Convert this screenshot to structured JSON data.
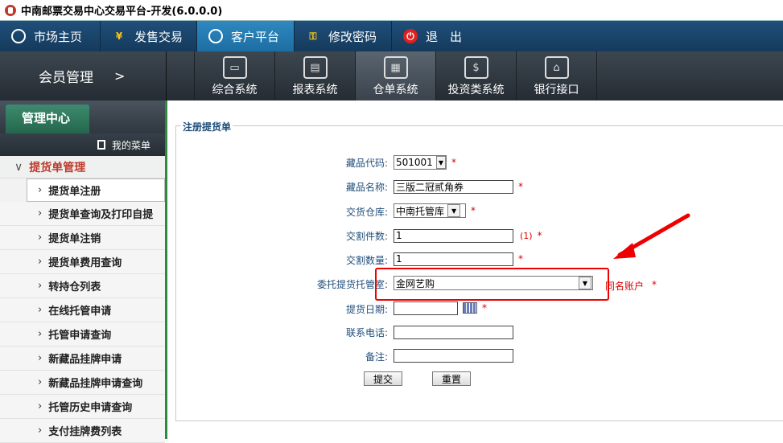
{
  "window": {
    "title": "中南邮票交易中心交易平台-开发(6.0.0.0)"
  },
  "topnav": [
    {
      "label": "市场主页",
      "icon": "market-icon"
    },
    {
      "label": "发售交易",
      "icon": "yen-icon"
    },
    {
      "label": "客户平台",
      "icon": "client-icon",
      "active": true
    },
    {
      "label": "修改密码",
      "icon": "key-icon"
    },
    {
      "label": "退　出",
      "icon": "power-icon"
    }
  ],
  "subnav": {
    "member_label": "会员管理",
    "member_chevron": ">",
    "systems": [
      {
        "label": "综合系统",
        "icon": "monitors-icon"
      },
      {
        "label": "报表系统",
        "icon": "report-icon"
      },
      {
        "label": "仓单系统",
        "icon": "warehouse-icon",
        "active": true
      },
      {
        "label": "投资类系统",
        "icon": "invest-icon"
      },
      {
        "label": "银行接口",
        "icon": "bank-icon"
      }
    ]
  },
  "sidebar": {
    "tab_label": "管理中心",
    "mymenu_label": "我的菜单",
    "group_label": "提货单管理",
    "items": [
      {
        "label": "提货单注册",
        "selected": true
      },
      {
        "label": "提货单查询及打印自提"
      },
      {
        "label": "提货单注销"
      },
      {
        "label": "提货单费用查询"
      },
      {
        "label": "转持仓列表"
      },
      {
        "label": "在线托管申请"
      },
      {
        "label": "托管申请查询"
      },
      {
        "label": "新藏品挂牌申请"
      },
      {
        "label": "新藏品挂牌申请查询"
      },
      {
        "label": "托管历史申请查询"
      },
      {
        "label": "支付挂牌费列表"
      }
    ]
  },
  "form": {
    "legend": "注册提货单",
    "required_mark": "*",
    "fields": {
      "code": {
        "label": "藏品代码:",
        "value": "501001"
      },
      "name": {
        "label": "藏品名称:",
        "value": "三版二冠贰角券"
      },
      "warehouse": {
        "label": "交货仓库:",
        "value": "中南托管库"
      },
      "pieces": {
        "label": "交割件数:",
        "value": "1",
        "hint": "(1)"
      },
      "quantity": {
        "label": "交割数量:",
        "value": "1"
      },
      "custodian": {
        "label": "委托提货托管室:",
        "value": "金网艺购",
        "note": "同名账户"
      },
      "date": {
        "label": "提货日期:",
        "value": ""
      },
      "phone": {
        "label": "联系电话:",
        "value": ""
      },
      "remark": {
        "label": "备注:",
        "value": ""
      }
    },
    "buttons": {
      "submit": "提交",
      "reset": "重置"
    }
  },
  "colors": {
    "highlight": "#e00000",
    "accent": "#2e8b3e",
    "label": "#1f4d7a"
  }
}
